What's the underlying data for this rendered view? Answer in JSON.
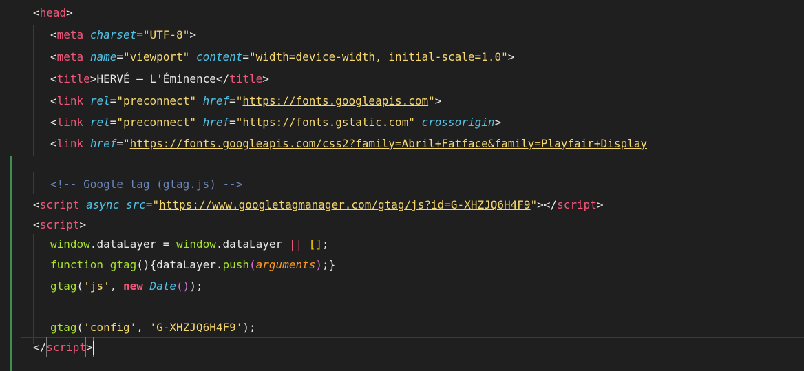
{
  "editor": {
    "theme": {
      "background": "#1f1f1f",
      "tag_color": "#f0577a",
      "attr_color": "#4fc3e6",
      "string_color": "#f5d76e",
      "comment_color": "#6a86b8",
      "function_color": "#a6e22e",
      "modified_gutter_color": "#3f8f52"
    },
    "lines": [
      {
        "parts": [
          "<",
          "head",
          ">"
        ]
      },
      {
        "parts": [
          "<",
          "meta",
          " ",
          "charset",
          "=",
          "\"UTF-8\"",
          ">"
        ]
      },
      {
        "parts": [
          "<",
          "meta",
          " ",
          "name",
          "=",
          "\"viewport\"",
          " ",
          "content",
          "=",
          "\"width=device-width, initial-scale=1.0\"",
          ">"
        ]
      },
      {
        "parts": [
          "<",
          "title",
          ">",
          "HERVÉ — L'Éminence",
          "</",
          "title",
          ">"
        ]
      },
      {
        "parts": [
          "<",
          "link",
          " ",
          "rel",
          "=",
          "\"preconnect\"",
          " ",
          "href",
          "=",
          "\"",
          "https://fonts.googleapis.com",
          "\"",
          ">"
        ]
      },
      {
        "parts": [
          "<",
          "link",
          " ",
          "rel",
          "=",
          "\"preconnect\"",
          " ",
          "href",
          "=",
          "\"",
          "https://fonts.gstatic.com",
          "\"",
          " ",
          "crossorigin",
          ">"
        ]
      },
      {
        "parts": [
          "<",
          "link",
          " ",
          "href",
          "=",
          "\"",
          "https://fonts.googleapis.com/css2?family=Abril+Fatface&family=Playfair+Display"
        ]
      },
      {
        "parts": []
      },
      {
        "parts": [
          "<!-- Google tag (gtag.js) -->"
        ]
      },
      {
        "parts": [
          "<",
          "script",
          " ",
          "async",
          " ",
          "src",
          "=",
          "\"",
          "https://www.googletagmanager.com/gtag/js?id=G-XHZJQ6H4F9",
          "\"",
          "></",
          "script",
          ">"
        ]
      },
      {
        "parts": [
          "<",
          "script",
          ">"
        ]
      },
      {
        "parts": [
          "window",
          ".",
          "dataLayer",
          " = ",
          "window",
          ".",
          "dataLayer",
          " ",
          "||",
          " ",
          "[]",
          ";"
        ]
      },
      {
        "parts": [
          "function",
          " ",
          "gtag",
          "()",
          "{",
          "dataLayer",
          ".",
          "push",
          "(",
          "arguments",
          ")",
          ";",
          "}"
        ]
      },
      {
        "parts": [
          "gtag",
          "(",
          "'js'",
          ", ",
          "new",
          " ",
          "Date",
          "()",
          ")",
          ";"
        ]
      },
      {
        "parts": []
      },
      {
        "parts": [
          "gtag",
          "(",
          "'config'",
          ", ",
          "'G-XHZJQ6H4F9'",
          ")",
          ";"
        ]
      },
      {
        "parts": [
          "</",
          "script",
          ">"
        ]
      },
      {
        "parts": []
      }
    ]
  }
}
